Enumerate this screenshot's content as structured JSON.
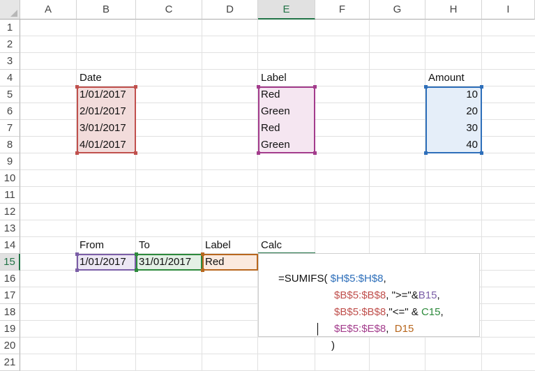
{
  "columns": [
    "A",
    "B",
    "C",
    "D",
    "E",
    "F",
    "G",
    "H",
    "I"
  ],
  "active_column": "E",
  "rows": [
    "1",
    "2",
    "3",
    "4",
    "5",
    "6",
    "7",
    "8",
    "9",
    "10",
    "11",
    "12",
    "13",
    "14",
    "15",
    "16",
    "17",
    "18",
    "19",
    "20",
    "21"
  ],
  "active_row": "15",
  "headers": {
    "date": "Date",
    "label": "Label",
    "amount": "Amount",
    "from": "From",
    "to": "To",
    "label2": "Label",
    "calc": "Calc"
  },
  "dates": [
    "1/01/2017",
    "2/01/2017",
    "3/01/2017",
    "4/01/2017"
  ],
  "labels": [
    "Red",
    "Green",
    "Red",
    "Green"
  ],
  "amounts": [
    "10",
    "20",
    "30",
    "40"
  ],
  "criteria": {
    "from": "1/01/2017",
    "to": "31/01/2017",
    "label": "Red"
  },
  "formula": {
    "line1_prefix": "=SUMIFS(",
    "line1_ref": "$H$5:$H$8",
    "line1_tail": ",",
    "line2_ref": "$B$5:$B$8",
    "line2_op": ", \">=\"&",
    "line2_cell": "B15",
    "line2_tail": ",",
    "line3_ref": "$B$5:$B$8",
    "line3_op": ",\"<=\" & ",
    "line3_cell": "C15",
    "line3_tail": ",",
    "line4_ref": "$E$5:$E$8",
    "line4_op": ",  ",
    "line4_cell": "D15",
    "line5": ")"
  },
  "colors": {
    "date_range": "#c0504d",
    "label_range": "#a33c8c",
    "amount_range": "#2e6fba",
    "from_cell": "#7b5ea7",
    "to_cell": "#2d8a3c",
    "label_cell": "#b8671e",
    "active_green": "#217346"
  }
}
